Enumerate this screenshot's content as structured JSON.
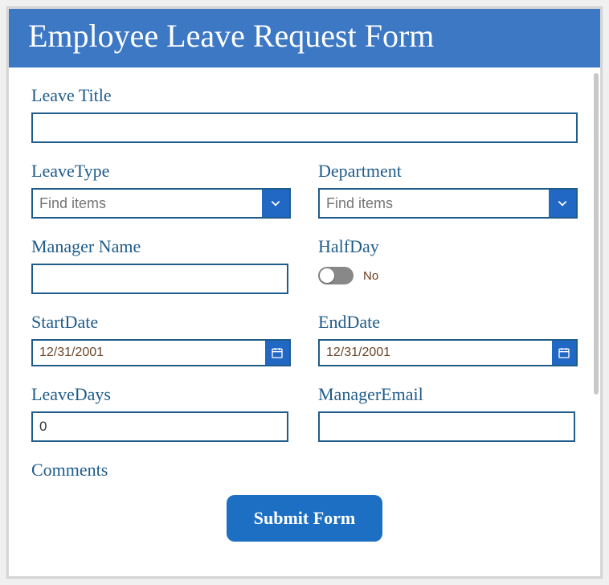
{
  "header": {
    "title": "Employee Leave Request Form"
  },
  "fields": {
    "leaveTitle": {
      "label": "Leave Title",
      "value": ""
    },
    "leaveType": {
      "label": "LeaveType",
      "placeholder": "Find items"
    },
    "department": {
      "label": "Department",
      "placeholder": "Find items"
    },
    "managerName": {
      "label": "Manager Name",
      "value": ""
    },
    "halfDay": {
      "label": "HalfDay",
      "stateLabel": "No"
    },
    "startDate": {
      "label": "StartDate",
      "value": "12/31/2001"
    },
    "endDate": {
      "label": "EndDate",
      "value": "12/31/2001"
    },
    "leaveDays": {
      "label": "LeaveDays",
      "value": "0"
    },
    "managerEmail": {
      "label": "ManagerEmail",
      "value": ""
    },
    "comments": {
      "label": "Comments"
    }
  },
  "actions": {
    "submit": "Submit Form"
  }
}
